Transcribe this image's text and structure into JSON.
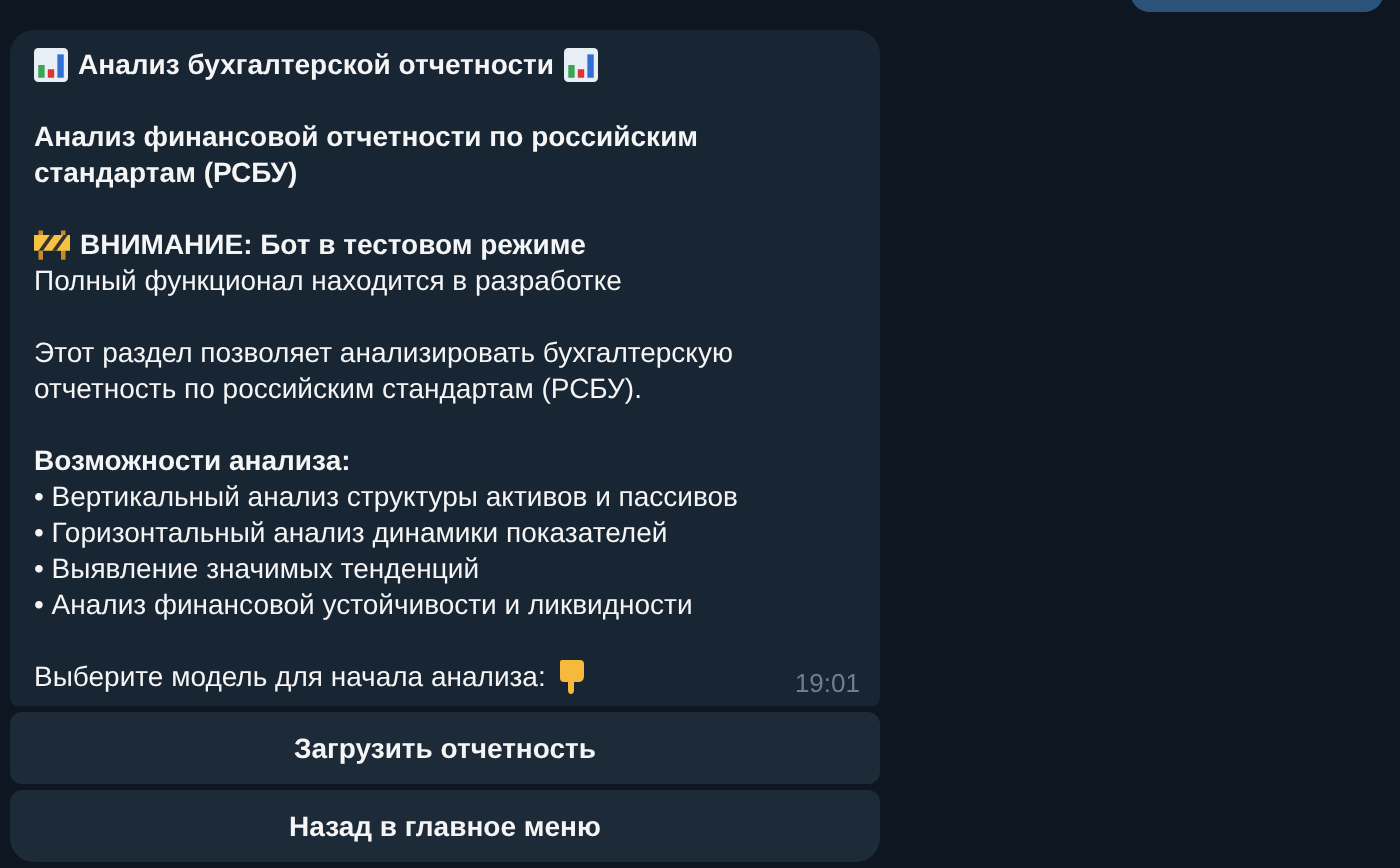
{
  "message": {
    "sections": [
      [
        {
          "kind": "title",
          "text": "Анализ бухгалтерской отчетности"
        }
      ],
      [
        {
          "kind": "bold",
          "text": "Анализ финансовой отчетности по российским стандартам (РСБУ)"
        }
      ],
      [
        {
          "kind": "warning",
          "text": "ВНИМАНИЕ: Бот в тестовом режиме"
        },
        {
          "kind": "text",
          "text": "Полный функционал находится в разработке"
        }
      ],
      [
        {
          "kind": "text",
          "text": "Этот раздел позволяет анализировать бухгалтерскую отчетность по российским стандартам (РСБУ)."
        }
      ],
      [
        {
          "kind": "bold",
          "text": "Возможности анализа:"
        },
        {
          "kind": "text",
          "text": "• Вертикальный анализ структуры активов и пассивов"
        },
        {
          "kind": "text",
          "text": "• Горизонтальный анализ динамики показателей"
        },
        {
          "kind": "text",
          "text": "• Выявление значимых тенденций"
        },
        {
          "kind": "text",
          "text": "• Анализ финансовой устойчивости и ликвидности"
        }
      ],
      [
        {
          "kind": "prompt",
          "text": "Выберите модель для начала анализа:"
        }
      ]
    ],
    "time": "19:01"
  },
  "buttons": [
    {
      "label": "Загрузить отчетность"
    },
    {
      "label": "Назад в главное меню"
    }
  ]
}
